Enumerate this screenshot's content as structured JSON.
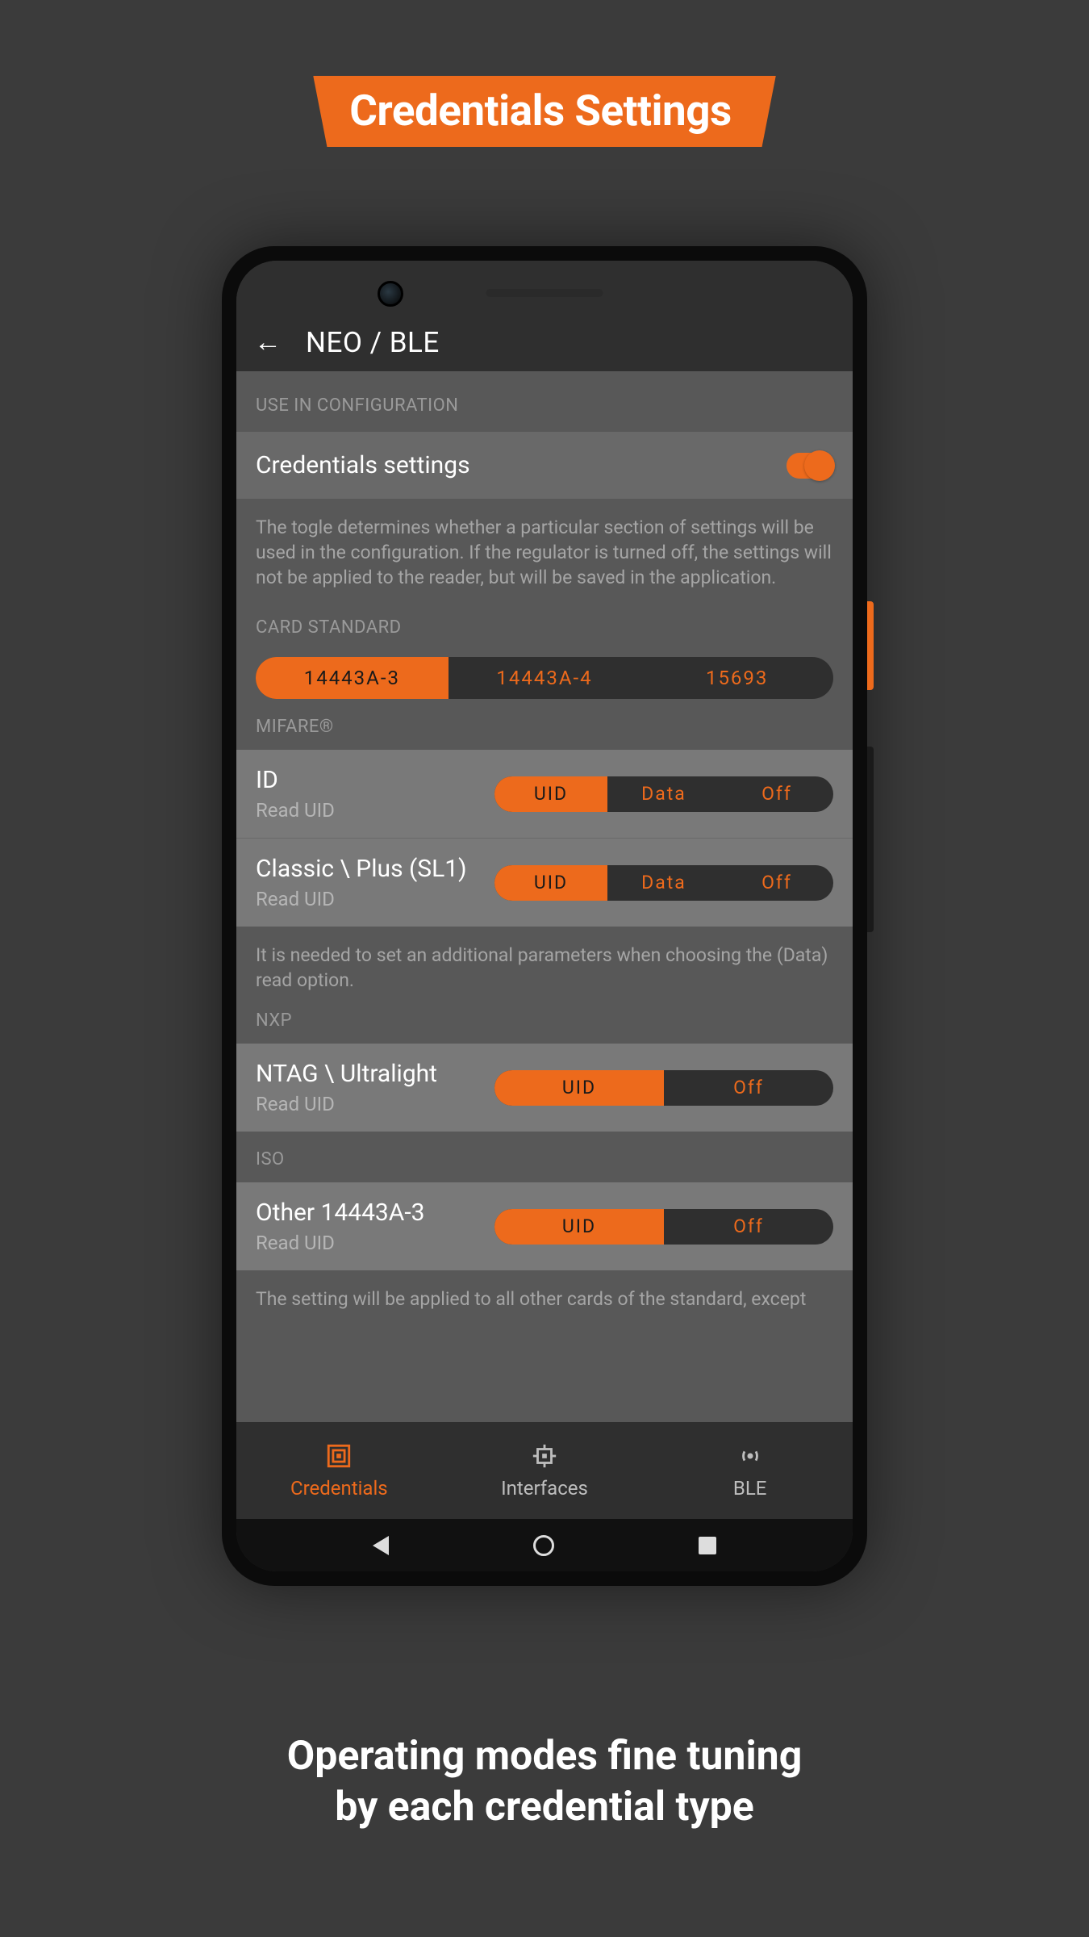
{
  "banner": "Credentials Settings",
  "caption_line1": "Operating modes fine tuning",
  "caption_line2": "by each credential type",
  "appbar": {
    "title": "NEO / BLE"
  },
  "sections": {
    "use_in_config": "USE IN CONFIGURATION",
    "card_standard": "CARD STANDARD",
    "mifare": "MIFARE®",
    "nxp": "NXP",
    "iso": "ISO"
  },
  "cred_toggle": {
    "title": "Credentials settings",
    "desc": "The togle determines whether a particular section of settings will be used in the configuration. If the regulator is turned off, the settings will not be applied to the reader, but will be saved in the application."
  },
  "card_standard_opts": {
    "a": "14443A-3",
    "b": "14443A-4",
    "c": "15693"
  },
  "rows": {
    "id": {
      "title": "ID",
      "sub": "Read UID"
    },
    "classic": {
      "title": "Classic \\ Plus (SL1)",
      "sub": "Read UID"
    },
    "ntag": {
      "title": "NTAG \\ Ultralight",
      "sub": "Read UID"
    },
    "other": {
      "title": "Other 14443A-3",
      "sub": "Read UID"
    }
  },
  "opts3": {
    "uid": "UID",
    "data": "Data",
    "off": "Off"
  },
  "opts2": {
    "uid": "UID",
    "off": "Off"
  },
  "mifare_note": "It is needed to set an additional parameters when choosing the (Data) read option.",
  "iso_note": "The setting will be applied to all other cards of the standard, except",
  "nav": {
    "credentials": "Credentials",
    "interfaces": "Interfaces",
    "ble": "BLE"
  }
}
